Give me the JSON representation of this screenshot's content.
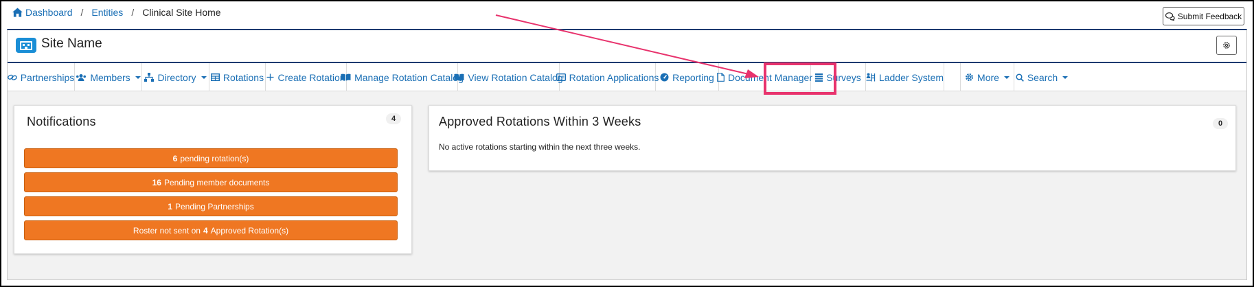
{
  "breadcrumb": {
    "home": "Dashboard",
    "entities": "Entities",
    "current": "Clinical Site Home",
    "separator": "/"
  },
  "feedback_button": "Submit Feedback",
  "site": {
    "title": "Site Name"
  },
  "nav": {
    "partnerships": "Partnerships",
    "members": "Members",
    "directory": "Directory",
    "rotations": "Rotations",
    "create_rotation": "Create Rotation",
    "manage_catalog": "Manage Rotation Catalog",
    "view_catalog": "View Rotation Catalog",
    "applications": "Rotation Applications",
    "reporting": "Reporting",
    "document_manager": "Document Manager",
    "surveys": "Surveys",
    "ladder_system": "Ladder System",
    "more": "More",
    "search": "Search"
  },
  "notifications": {
    "title": "Notifications",
    "count": "4",
    "items": [
      {
        "bold": "6",
        "text": "pending rotation(s)"
      },
      {
        "bold": "16",
        "text": "Pending member documents"
      },
      {
        "bold": "1",
        "text": "Pending Partnerships"
      },
      {
        "prefix": "Roster not sent on",
        "bold": "4",
        "text": "Approved Rotation(s)"
      }
    ]
  },
  "approved": {
    "title": "Approved Rotations Within 3 Weeks",
    "count": "0",
    "empty": "No active rotations starting within the next three weeks."
  },
  "colors": {
    "link": "#1a6fb5",
    "notification": "#ef7722",
    "highlight": "#e8336d",
    "header_rule": "#1d3a70"
  }
}
